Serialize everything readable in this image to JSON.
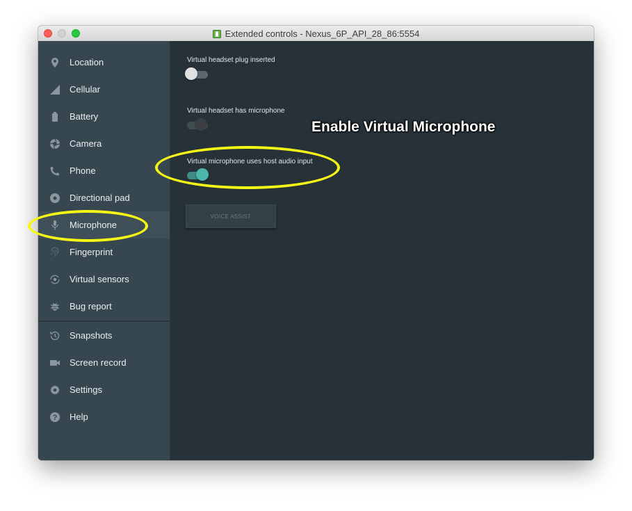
{
  "window": {
    "title": "Extended controls - Nexus_6P_API_28_86:5554"
  },
  "sidebar": {
    "items": [
      {
        "label": "Location",
        "icon": "location-pin-icon"
      },
      {
        "label": "Cellular",
        "icon": "signal-icon"
      },
      {
        "label": "Battery",
        "icon": "battery-icon"
      },
      {
        "label": "Camera",
        "icon": "camera-shutter-icon"
      },
      {
        "label": "Phone",
        "icon": "phone-icon"
      },
      {
        "label": "Directional pad",
        "icon": "dpad-icon"
      },
      {
        "label": "Microphone",
        "icon": "microphone-icon",
        "selected": true
      },
      {
        "label": "Fingerprint",
        "icon": "fingerprint-icon"
      },
      {
        "label": "Virtual sensors",
        "icon": "rotate-icon"
      },
      {
        "label": "Bug report",
        "icon": "bug-icon"
      },
      {
        "label": "Snapshots",
        "icon": "history-icon"
      },
      {
        "label": "Screen record",
        "icon": "video-camera-icon"
      },
      {
        "label": "Settings",
        "icon": "gear-icon"
      },
      {
        "label": "Help",
        "icon": "help-icon"
      }
    ]
  },
  "main": {
    "settings": [
      {
        "label": "Virtual headset plug inserted",
        "state": "off"
      },
      {
        "label": "Virtual headset has microphone",
        "state": "off-disabled"
      },
      {
        "label": "Virtual microphone uses host audio input",
        "state": "on"
      }
    ],
    "voice_assist_label": "VOICE ASSIST"
  },
  "annotation": {
    "text": "Enable Virtual Microphone"
  },
  "colors": {
    "sidebar_bg": "#37474f",
    "main_bg": "#263238",
    "toggle_on": "#4db6ac",
    "highlight": "#f7f716"
  }
}
